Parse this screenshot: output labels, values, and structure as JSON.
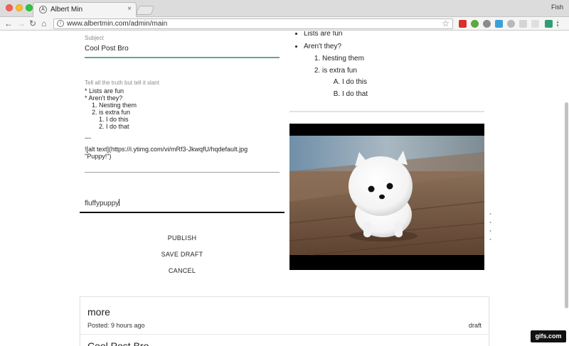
{
  "browser": {
    "tab_title": "Albert Min",
    "tab_close": "×",
    "profile_name": "Fish",
    "url": "www.albertmin.com/admin/main",
    "nav": {
      "back": "←",
      "forward": "→",
      "reload": "↻",
      "home": "⌂"
    },
    "star": "☆",
    "info": "i"
  },
  "editor": {
    "subject_label": "Subject",
    "subject_value": "Cool Post Bro",
    "body_label": "Tell all the truth but tell it slant",
    "body_lines": [
      "* Lists are fun",
      "* Aren't they?",
      "    1. Nesting them",
      "    2. is extra fun",
      "        1. I do this",
      "        2. I do that",
      "",
      "---",
      "",
      "![alt text](https://i.ytimg.com/vi/mRf3-JkwqfU/hqdefault.jpg",
      "\"Puppy!\")"
    ],
    "tags_value": "fluffypuppy"
  },
  "actions": {
    "publish": "PUBLISH",
    "save_draft": "SAVE DRAFT",
    "cancel": "CANCEL"
  },
  "preview": {
    "items": [
      "Lists are fun",
      "Aren't they?"
    ],
    "nested": [
      "Nesting them",
      "is extra fun"
    ],
    "subnested": [
      "I do this",
      "I do that"
    ]
  },
  "posts": [
    {
      "title": "more",
      "posted": "Posted: 9 hours ago",
      "status": "draft"
    },
    {
      "title": "Cool Post Bro"
    }
  ],
  "watermark": "gifs.com",
  "colors": {
    "subject_underline": "#6aa38a"
  }
}
